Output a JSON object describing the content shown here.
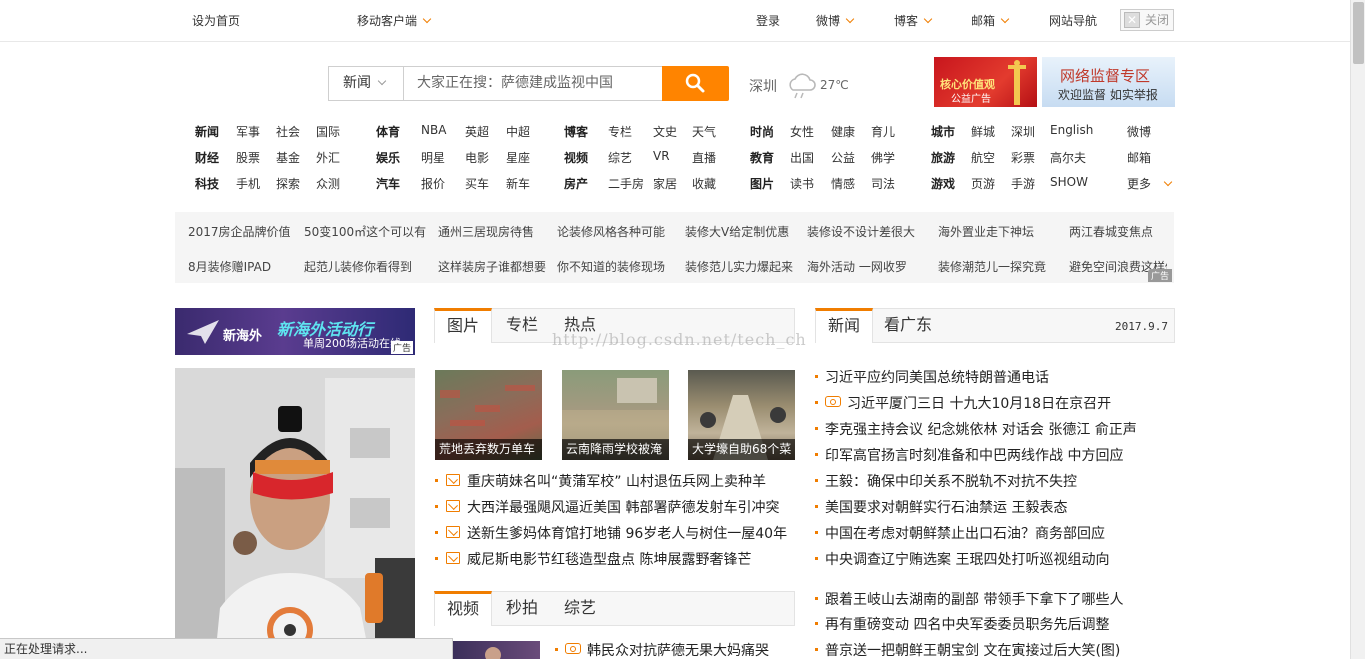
{
  "topbar": {
    "set_home": "设为首页",
    "mobile_client": "移动客户端",
    "login": "登录",
    "weibo": "微博",
    "blog": "博客",
    "mail": "邮箱",
    "site_nav": "网站导航",
    "close": "关闭"
  },
  "search": {
    "channel": "新闻",
    "query": "大家正在搜：萨德建成监视中国"
  },
  "weather": {
    "city": "深圳",
    "temp": "27℃"
  },
  "ads": {
    "left_t1": "核心价值观",
    "left_t2": "公益广告",
    "right_t1": "网络监督专区",
    "right_t2": "欢迎监督 如实举报"
  },
  "nav": {
    "g1": [
      [
        "新闻",
        "军事",
        "社会",
        "国际"
      ],
      [
        "财经",
        "股票",
        "基金",
        "外汇"
      ],
      [
        "科技",
        "手机",
        "探索",
        "众测"
      ]
    ],
    "g2": [
      [
        "体育",
        "NBA",
        "英超",
        "中超"
      ],
      [
        "娱乐",
        "明星",
        "电影",
        "星座"
      ],
      [
        "汽车",
        "报价",
        "买车",
        "新车"
      ]
    ],
    "g3": [
      [
        "博客",
        "专栏",
        "文史",
        "天气"
      ],
      [
        "视频",
        "综艺",
        "VR",
        "直播"
      ],
      [
        "房产",
        "二手房",
        "家居",
        "收藏"
      ]
    ],
    "g4": [
      [
        "时尚",
        "女性",
        "健康",
        "育儿"
      ],
      [
        "教育",
        "出国",
        "公益",
        "佛学"
      ],
      [
        "图片",
        "读书",
        "情感",
        "司法"
      ]
    ],
    "g5": [
      [
        "城市",
        "鲜城",
        "深圳",
        "English"
      ],
      [
        "旅游",
        "航空",
        "彩票",
        "高尔夫"
      ],
      [
        "游戏",
        "页游",
        "手游",
        "SHOW"
      ]
    ],
    "g6": [
      "微博",
      "邮箱",
      "更多"
    ]
  },
  "promo": {
    "row1": [
      "2017房企品牌价值",
      "50变100㎡这个可以有",
      "通州三居现房待售",
      "论装修风格各种可能",
      "装修大V给定制优惠",
      "装修设不设计差很大",
      "海外置业走下神坛",
      "两江春城变焦点"
    ],
    "row2": [
      "8月装修赠IPAD",
      "起范儿装修你看得到",
      "这样装房子谁都想要",
      "你不知道的装修现场",
      "装修范儿实力爆起来",
      "海外活动 一网收罗",
      "装修潮范儿一探究竟",
      "避免空间浪费这样做"
    ],
    "ad_tag": "广告"
  },
  "left_ad": {
    "title": "新海外活动行",
    "sub": "单周200场活动在线",
    "logo": "新海外",
    "tag": "广告"
  },
  "photo_tabs": [
    "图片",
    "专栏",
    "热点"
  ],
  "thumbs": [
    "荒地丢弃数万单车",
    "云南降雨学校被淹",
    "大学壕自助68个菜"
  ],
  "photo_news": [
    "重庆萌妹名叫“黄蒲军校” 山村退伍兵网上卖种羊",
    "大西洋最强飓风逼近美国 韩部署萨德发射车引冲突",
    "送新生爹妈体育馆打地铺 96岁老人与树住一屋40年",
    "威尼斯电影节红毯造型盘点 陈坤展露野奢锋芒"
  ],
  "video_tabs": [
    "视频",
    "秒拍",
    "综艺"
  ],
  "video_news": [
    "韩民众对抗萨德无果大妈痛哭"
  ],
  "news_tabs": [
    "新闻",
    "看广东"
  ],
  "news_date": "2017.9.7",
  "news_list": [
    "习近平应约同美国总统特朗普通电话",
    "习近平厦门三日 十九大10月18日在京召开",
    "李克强主持会议 纪念姚依林 对话会 张德江 俞正声",
    "印军高官扬言时刻准备和中巴两线作战 中方回应",
    "王毅：确保中印关系不脱轨不对抗不失控",
    "美国要求对朝鲜实行石油禁运 王毅表态",
    "中国在考虑对朝鲜禁止出口石油？商务部回应",
    "中央调查辽宁贿选案 王珉四处打听巡视组动向",
    "跟着王岐山去湖南的副部 带领手下拿下了哪些人",
    "再有重磅变动 四名中央军委委员职务先后调整",
    "普京送一把朝鲜王朝宝剑 文在寅接过后大笑(图)"
  ],
  "watermark": "http://blog.csdn.net/tech_ch",
  "status": "正在处理请求..."
}
